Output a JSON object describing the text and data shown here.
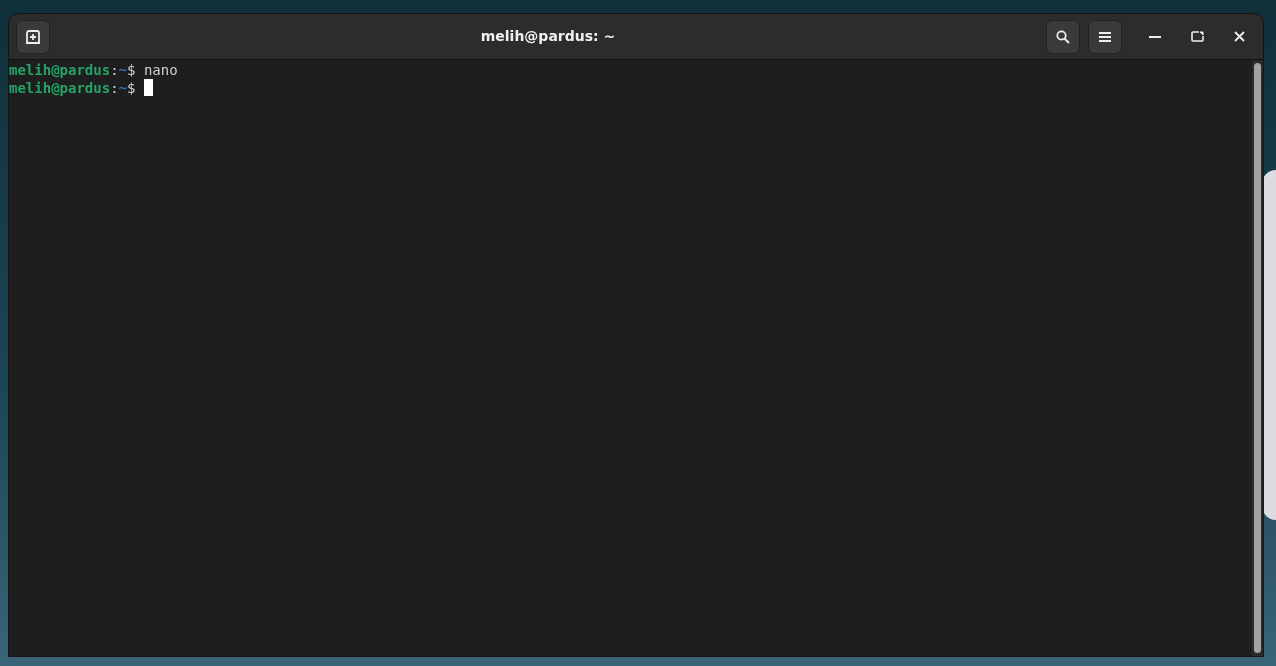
{
  "window": {
    "title": "melih@pardus: ~"
  },
  "terminal": {
    "lines": [
      {
        "user": "melih@pardus",
        "separator": ":",
        "path": "~",
        "prompt": "$",
        "command": "nano",
        "cursor": false
      },
      {
        "user": "melih@pardus",
        "separator": ":",
        "path": "~",
        "prompt": "$",
        "cursor": true
      }
    ]
  }
}
